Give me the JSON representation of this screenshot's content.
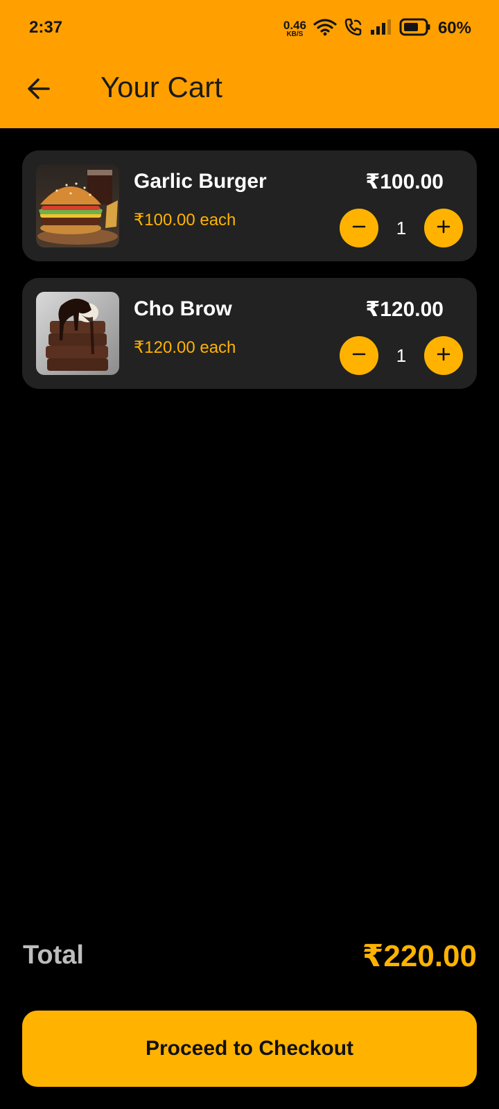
{
  "status_bar": {
    "time": "2:37",
    "net_speed_value": "0.46",
    "net_speed_unit": "KB/S",
    "battery_percent": "60%",
    "icons": [
      "wifi-icon",
      "wifi-call-icon",
      "signal-icon",
      "battery-icon"
    ]
  },
  "app_bar": {
    "back_icon": "arrow-left-icon",
    "title": "Your Cart"
  },
  "colors": {
    "header_bg": "#FFA000",
    "accent": "#FFB300",
    "card_bg": "#222222",
    "page_bg": "#000000"
  },
  "cart": {
    "items": [
      {
        "name": "Garlic Burger",
        "unit_price": "₹100.00 each",
        "line_total": "₹100.00",
        "quantity": "1",
        "image": "burger-photo"
      },
      {
        "name": "Cho Brow",
        "unit_price": "₹120.00 each",
        "line_total": "₹120.00",
        "quantity": "1",
        "image": "brownie-photo"
      }
    ]
  },
  "summary": {
    "total_label": "Total",
    "total_value": "₹220.00"
  },
  "actions": {
    "checkout_label": "Proceed to Checkout"
  }
}
